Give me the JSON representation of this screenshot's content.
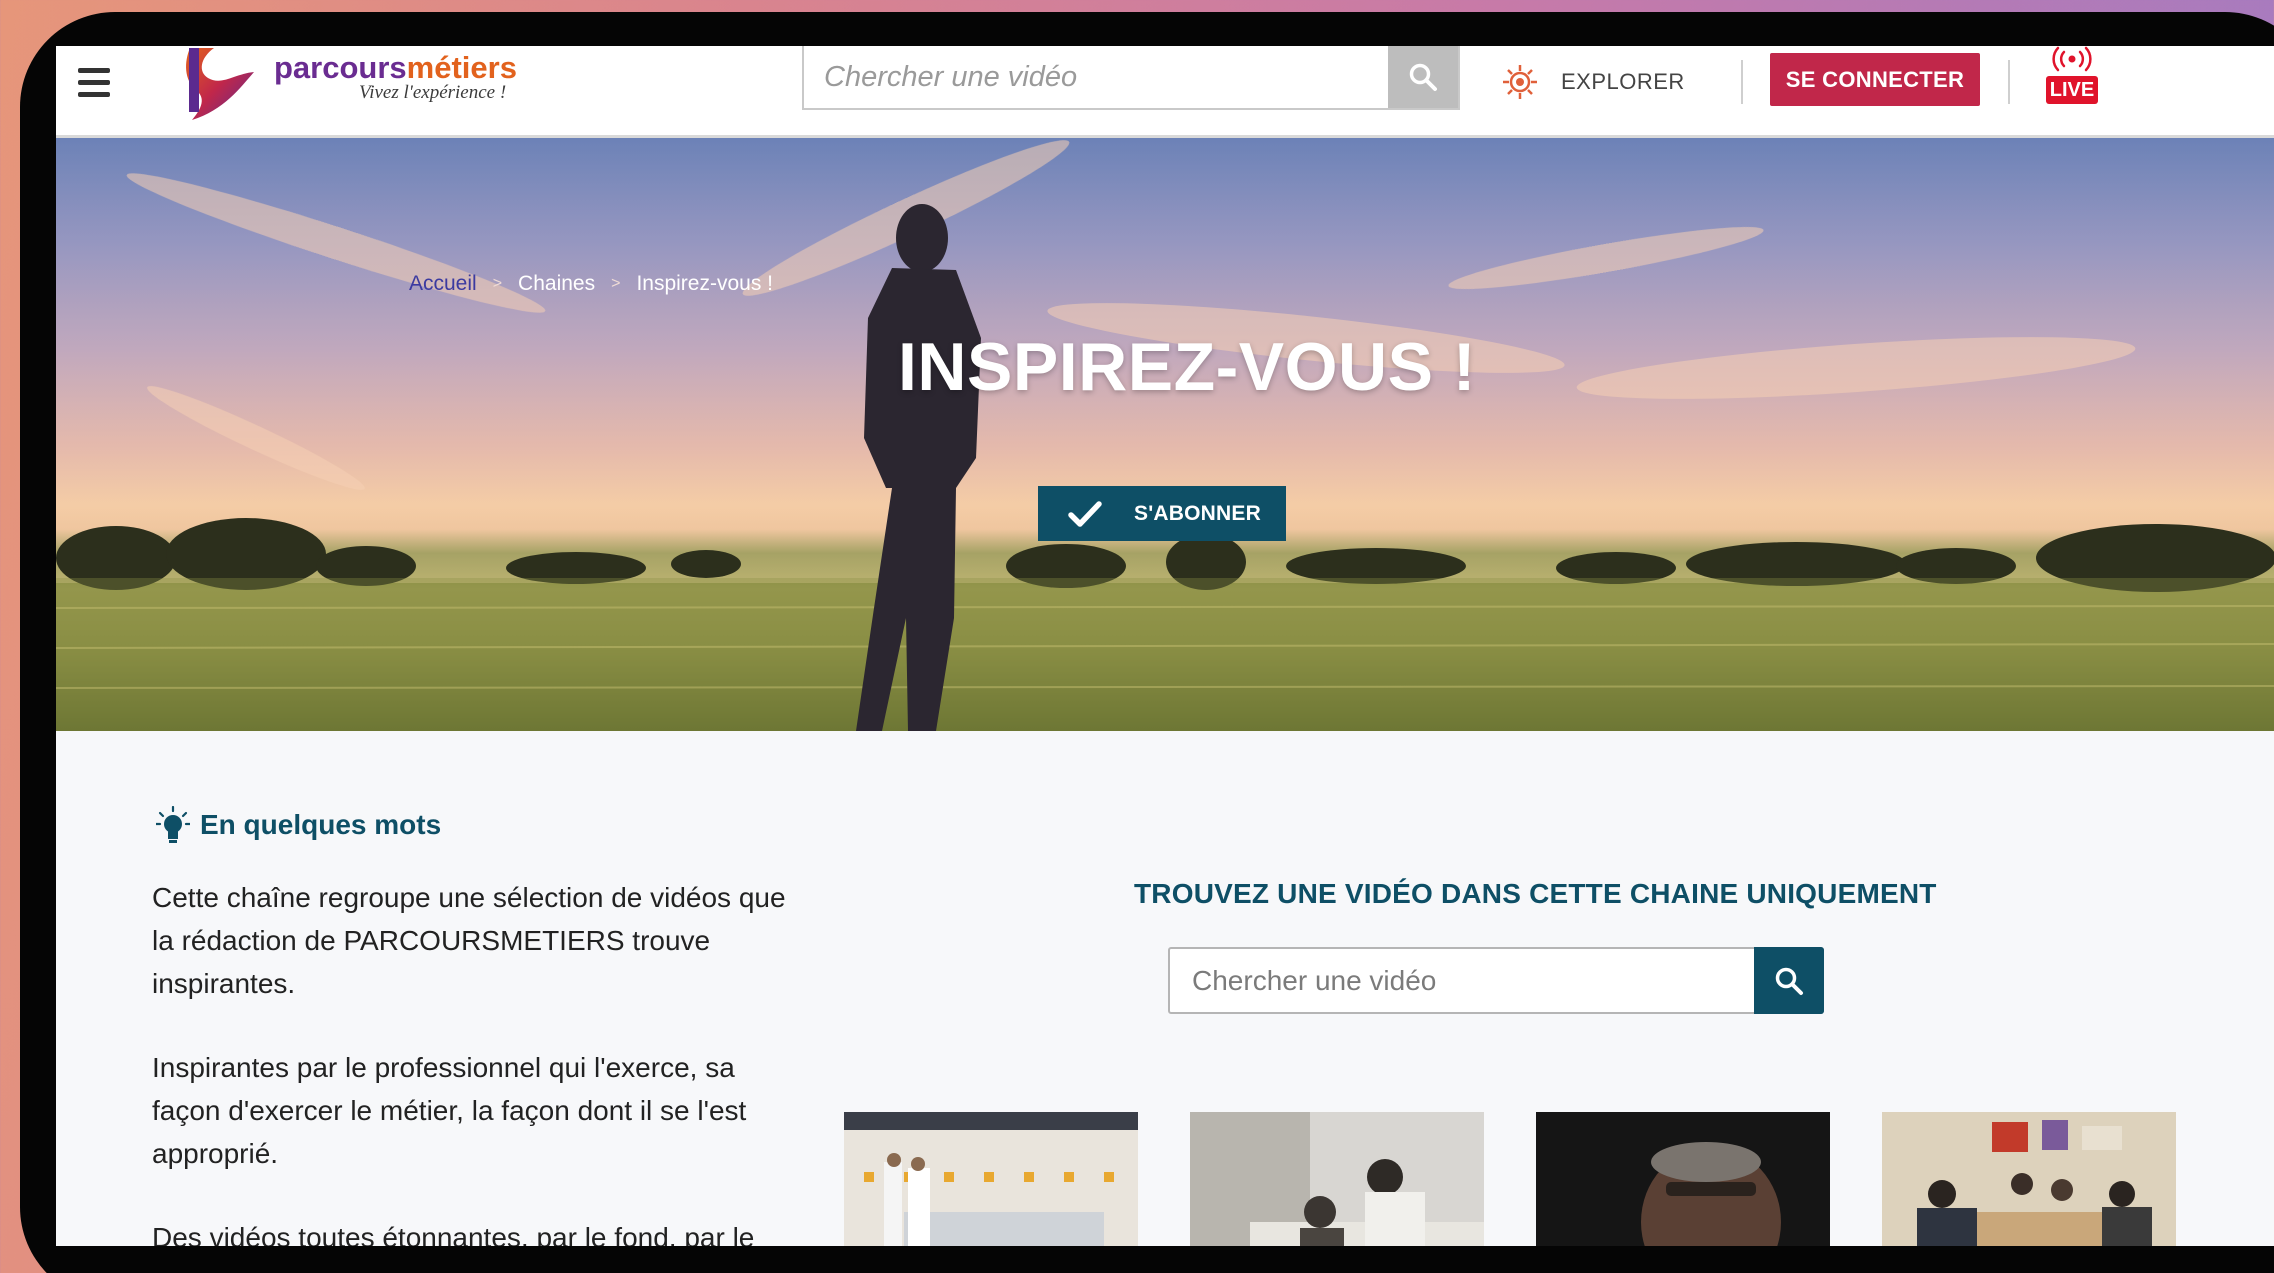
{
  "header": {
    "logo_name_part1": "parcours",
    "logo_name_part2": "métiers",
    "logo_tagline": "Vivez l'expérience !",
    "search_placeholder": "Chercher une vidéo",
    "explore_label": "EXPLORER",
    "connect_label": "SE CONNECTER",
    "live_label": "LIVE"
  },
  "hero": {
    "breadcrumb": [
      "Accueil",
      "Chaines",
      "Inspirez-vous !"
    ],
    "breadcrumb_separator": ">",
    "title": "INSPIREZ-VOUS !",
    "subscribe_label": "S'ABONNER"
  },
  "about": {
    "heading": "En quelques mots",
    "paragraphs": [
      "Cette chaîne regroupe une sélection de vidéos que la rédaction de PARCOURSMETIERS trouve inspirantes.",
      "Inspirantes par le professionnel qui l'exerce, sa façon d'exercer le métier, la façon dont il se l'est approprié.",
      "Des vidéos toutes étonnantes, par le fond, par le"
    ]
  },
  "channel_search": {
    "title": "TROUVEZ UNE VIDÉO DANS CETTE CHAINE UNIQUEMENT",
    "placeholder": "Chercher une vidéo"
  },
  "icons": {
    "menu": "hamburger-icon",
    "search": "search-icon",
    "explore": "compass-icon",
    "live": "broadcast-icon",
    "subscribe": "checkmark-icon",
    "about": "lightbulb-icon"
  },
  "colors": {
    "brand_purple": "#6a2c91",
    "brand_orange": "#e2621d",
    "connect_red": "#c1274a",
    "teal": "#0e4f66",
    "live_red": "#e0132b"
  }
}
